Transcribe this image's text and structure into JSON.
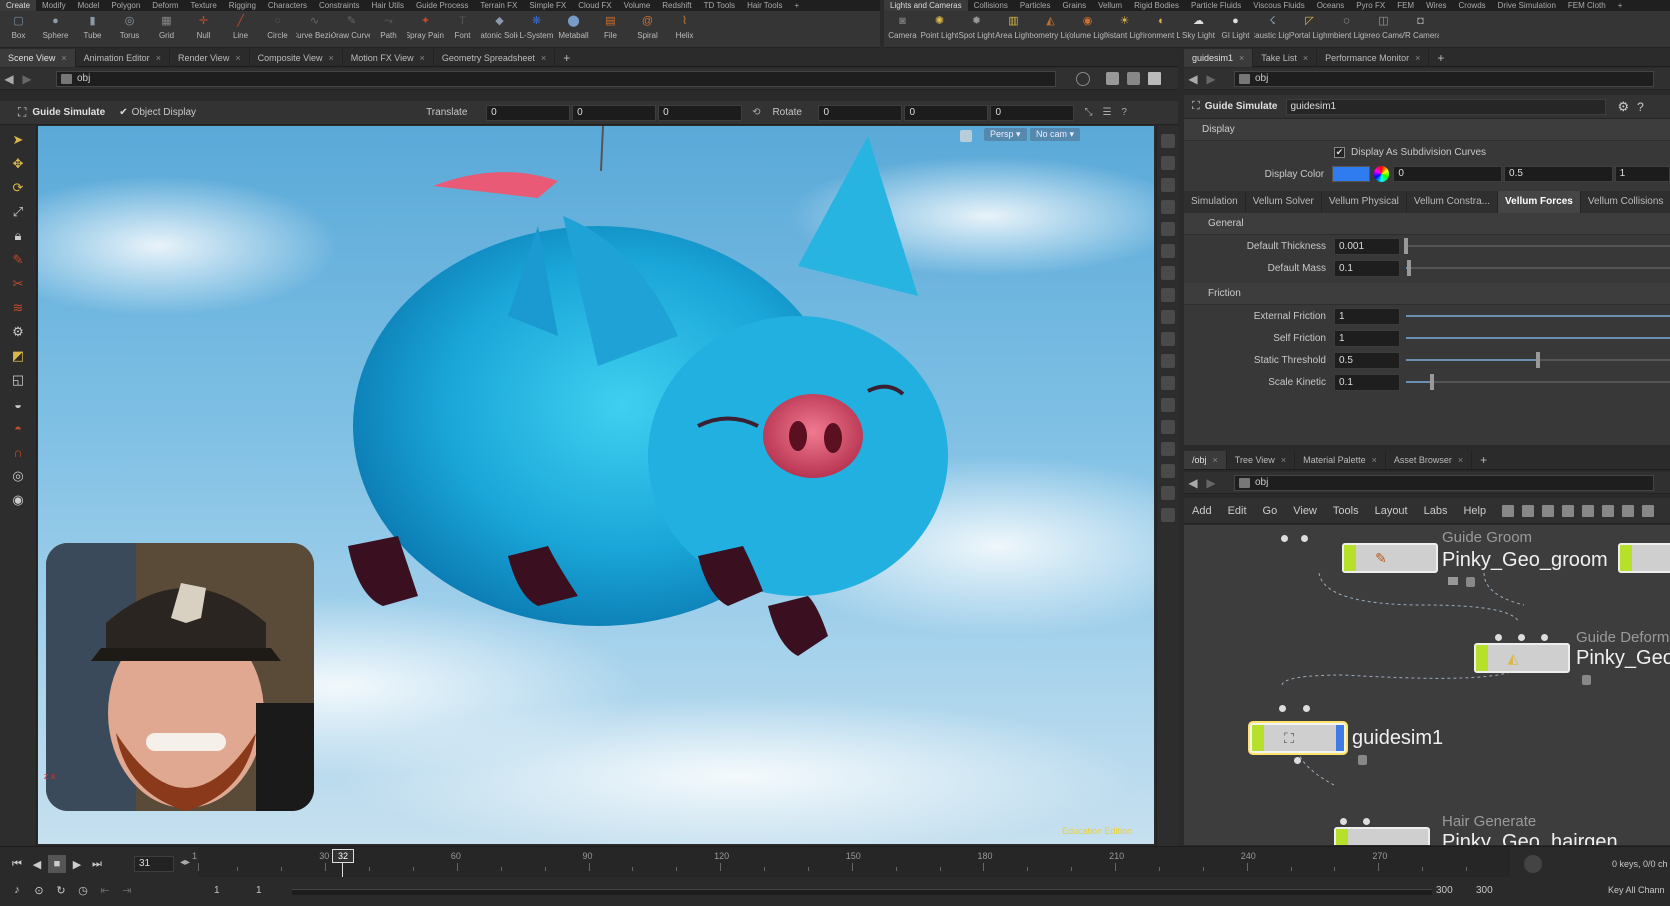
{
  "shelf": {
    "tabs_left": [
      "Create",
      "Modify",
      "Model",
      "Polygon",
      "Deform",
      "Texture",
      "Rigging",
      "Characters",
      "Constraints",
      "Hair Utils",
      "Guide Process",
      "Terrain FX",
      "Simple FX",
      "Cloud FX",
      "Volume",
      "Redshift",
      "TD Tools",
      "Hair Tools",
      "+"
    ],
    "tabs_right": [
      "Lights and Cameras",
      "Collisions",
      "Particles",
      "Grains",
      "Vellum",
      "Rigid Bodies",
      "Particle Fluids",
      "Viscous Fluids",
      "Oceans",
      "Pyro FX",
      "FEM",
      "Wires",
      "Crowds",
      "Drive Simulation",
      "FEM Cloth",
      "+"
    ],
    "tools_left": [
      {
        "label": "Box",
        "icon": "box-icon",
        "glyph": "▢",
        "color": "#7a8ca0"
      },
      {
        "label": "Sphere",
        "icon": "sphere-icon",
        "glyph": "●",
        "color": "#8a9aa8"
      },
      {
        "label": "Tube",
        "icon": "tube-icon",
        "glyph": "▮",
        "color": "#8a9aa8"
      },
      {
        "label": "Torus",
        "icon": "torus-icon",
        "glyph": "◎",
        "color": "#8a9aa8"
      },
      {
        "label": "Grid",
        "icon": "grid-icon",
        "glyph": "▦",
        "color": "#888"
      },
      {
        "label": "Null",
        "icon": "null-icon",
        "glyph": "✛",
        "color": "#c24a2a"
      },
      {
        "label": "Line",
        "icon": "line-icon",
        "glyph": "╱",
        "color": "#c24a2a"
      },
      {
        "label": "Circle",
        "icon": "circle-icon",
        "glyph": "○",
        "color": "#555"
      },
      {
        "label": "Curve Bezier",
        "icon": "curve-bezier-icon",
        "glyph": "∿",
        "color": "#666"
      },
      {
        "label": "Draw Curve",
        "icon": "draw-curve-icon",
        "glyph": "✎",
        "color": "#666"
      },
      {
        "label": "Path",
        "icon": "path-icon",
        "glyph": "⤳",
        "color": "#666"
      },
      {
        "label": "Spray Paint",
        "icon": "spray-paint-icon",
        "glyph": "✦",
        "color": "#c24a2a"
      },
      {
        "label": "Font",
        "icon": "font-icon",
        "glyph": "T",
        "color": "#555"
      },
      {
        "label": "Platonic Solids",
        "icon": "platonic-solids-icon",
        "glyph": "◆",
        "color": "#8a9aa8"
      },
      {
        "label": "L-System",
        "icon": "l-system-icon",
        "glyph": "❋",
        "color": "#3a6ac8"
      },
      {
        "label": "Metaball",
        "icon": "metaball-icon",
        "glyph": "⬤",
        "color": "#7a9ac8"
      },
      {
        "label": "File",
        "icon": "file-icon",
        "glyph": "▤",
        "color": "#d07030"
      },
      {
        "label": "Spiral",
        "icon": "spiral-icon",
        "glyph": "@",
        "color": "#d07030"
      },
      {
        "label": "Helix",
        "icon": "helix-icon",
        "glyph": "⌇",
        "color": "#c08040"
      }
    ],
    "tools_right": [
      {
        "label": "Camera",
        "icon": "camera-icon",
        "glyph": "◙",
        "color": "#777"
      },
      {
        "label": "Point Light",
        "icon": "point-light-icon",
        "glyph": "✺",
        "color": "#d9b84a"
      },
      {
        "label": "Spot Light",
        "icon": "spot-light-icon",
        "glyph": "✹",
        "color": "#999"
      },
      {
        "label": "Area Light",
        "icon": "area-light-icon",
        "glyph": "▥",
        "color": "#d9b84a"
      },
      {
        "label": "Geometry Light",
        "icon": "geometry-light-icon",
        "glyph": "◭",
        "color": "#c07030"
      },
      {
        "label": "Volume Light",
        "icon": "volume-light-icon",
        "glyph": "◉",
        "color": "#d07030"
      },
      {
        "label": "Distant Light",
        "icon": "distant-light-icon",
        "glyph": "☀",
        "color": "#d9b84a"
      },
      {
        "label": "Environment Light",
        "icon": "environment-light-icon",
        "glyph": "◐",
        "color": "#d9b84a"
      },
      {
        "label": "Sky Light",
        "icon": "sky-light-icon",
        "glyph": "☁",
        "color": "#ddd"
      },
      {
        "label": "GI Light",
        "icon": "gi-light-icon",
        "glyph": "●",
        "color": "#ddd"
      },
      {
        "label": "Caustic Light",
        "icon": "caustic-light-icon",
        "glyph": "☇",
        "color": "#9ab"
      },
      {
        "label": "Portal Light",
        "icon": "portal-light-icon",
        "glyph": "◸",
        "color": "#d9b84a"
      },
      {
        "label": "Ambient Light",
        "icon": "ambient-light-icon",
        "glyph": "◌",
        "color": "#ddd"
      },
      {
        "label": "Stereo Camera",
        "icon": "stereo-camera-icon",
        "glyph": "◫",
        "color": "#999"
      },
      {
        "label": "VR Camera",
        "icon": "vr-camera-icon",
        "glyph": "◘",
        "color": "#999"
      }
    ]
  },
  "left_pane": {
    "tabs": [
      "Scene View",
      "Animation Editor",
      "Render View",
      "Composite View",
      "Motion FX View",
      "Geometry Spreadsheet"
    ],
    "path": "obj",
    "operator": {
      "tool_name": "Guide Simulate",
      "object_display": "Object Display",
      "translate_label": "Translate",
      "translate": [
        "0",
        "0",
        "0"
      ],
      "rotate_label": "Rotate",
      "rotate": [
        "0",
        "0",
        "0"
      ]
    },
    "viewport": {
      "persp": "Persp ▾",
      "camera": "No cam ▾",
      "watermark": "Education Edition",
      "axes": "z x"
    }
  },
  "right_pane": {
    "tabs": [
      "guidesim1",
      "Take List",
      "Performance Monitor"
    ],
    "path": "obj",
    "node_type": "Guide Simulate",
    "node_name": "guidesim1",
    "display_section": "Display",
    "display_subdiv": "Display As Subdivision Curves",
    "display_color_label": "Display Color",
    "display_color": [
      "0",
      "0.5",
      "1"
    ],
    "display_color_swatch": "#2f7cf0",
    "subtabs": [
      "Simulation",
      "Vellum Solver",
      "Vellum Physical",
      "Vellum Constra...",
      "Vellum Forces",
      "Vellum Collisions"
    ],
    "general_section": "General",
    "general": [
      {
        "label": "Default Thickness",
        "value": "0.001",
        "level": 0.0
      },
      {
        "label": "Default Mass",
        "value": "0.1",
        "level": 0.01
      }
    ],
    "friction_section": "Friction",
    "friction": [
      {
        "label": "External Friction",
        "value": "1",
        "level": 1.0
      },
      {
        "label": "Self Friction",
        "value": "1",
        "level": 1.0
      },
      {
        "label": "Static Threshold",
        "value": "0.5",
        "level": 0.5
      },
      {
        "label": "Scale Kinetic",
        "value": "0.1",
        "level": 0.1
      }
    ]
  },
  "network": {
    "tabs": [
      "/obj",
      "Tree View",
      "Material Palette",
      "Asset Browser"
    ],
    "path": "obj",
    "menu": [
      "Add",
      "Edit",
      "Go",
      "View",
      "Tools",
      "Layout",
      "Labs",
      "Help"
    ],
    "nodes": [
      {
        "type": "Guide Groom",
        "name": "Pinky_Geo_groom"
      },
      {
        "type": "Guide Deform",
        "name": "Pinky_Geo"
      },
      {
        "type": "",
        "name": "guidesim1"
      },
      {
        "type": "Hair Generate",
        "name": "Pinky_Geo_hairgen"
      }
    ]
  },
  "timeline": {
    "frame": "31",
    "current_marker": "32",
    "ticks": [
      "1",
      "30",
      "60",
      "90",
      "120",
      "150",
      "180",
      "210",
      "240",
      "270"
    ],
    "start": "1",
    "start2": "1",
    "end": "300",
    "end2": "300",
    "keys": "0 keys, 0/0 ch",
    "key_all": "Key All Chann"
  }
}
